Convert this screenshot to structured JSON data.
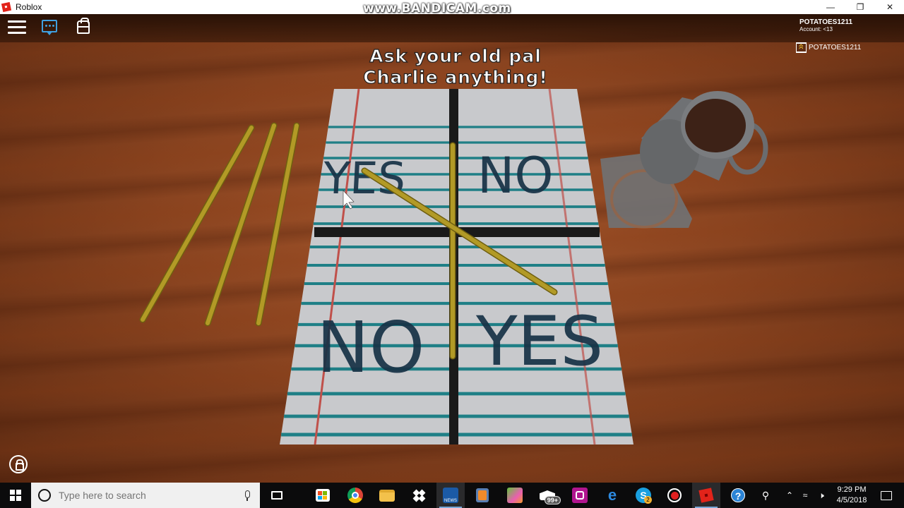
{
  "window": {
    "title": "Roblox",
    "watermark": "www.BANDICAM.com",
    "controls": {
      "minimize": "—",
      "restore": "❐",
      "close": "✕"
    }
  },
  "hud": {
    "menu_icon": "hamburger-menu-icon",
    "chat_icon": "chat-bubble-icon",
    "backpack_icon": "backpack-icon",
    "account_name": "POTATOES1211",
    "account_age": "Account: <13",
    "player_list": [
      {
        "name": "POTATOES1211",
        "badge": "premium-chevron-icon"
      }
    ],
    "shift_lock_icon": "shift-lock-icon"
  },
  "scene": {
    "sign_line1": "Ask your old pal",
    "sign_line2": "Charlie anything!",
    "board_labels": {
      "top_left": "YES",
      "top_right": "NO",
      "bottom_left": "NO",
      "bottom_right": "YES"
    },
    "objects": [
      "pencil",
      "pencil",
      "pencil",
      "pencil-vertical",
      "pencil-diagonal",
      "coffee-mug",
      "coaster"
    ],
    "colors": {
      "table_wood": "#8a4420",
      "paper": "#c8c9cc",
      "rule_line": "#1f7f86",
      "margin_line": "#c0504a",
      "grid_bar": "#1a1a1a",
      "label_text": "#173246",
      "pencil": "#b29a26",
      "mug": "#6f7174",
      "coffee": "#3d2217"
    }
  },
  "taskbar": {
    "search_placeholder": "Type here to search",
    "apps": [
      {
        "name": "task-view",
        "icon": "task-view-icon"
      },
      {
        "name": "microsoft-store",
        "icon": "store-icon"
      },
      {
        "name": "chrome",
        "icon": "chrome-icon"
      },
      {
        "name": "file-explorer",
        "icon": "folder-icon"
      },
      {
        "name": "dropbox",
        "icon": "dropbox-icon"
      },
      {
        "name": "abc-news",
        "icon": "abc-news-icon",
        "label": "NEWS"
      },
      {
        "name": "media-player",
        "icon": "play-icon"
      },
      {
        "name": "candy-crush",
        "icon": "candy-crush-icon"
      },
      {
        "name": "mail",
        "icon": "mail-icon",
        "badge": "99+"
      },
      {
        "name": "instagram",
        "icon": "instagram-icon"
      },
      {
        "name": "edge",
        "icon": "edge-icon"
      },
      {
        "name": "skype",
        "icon": "skype-icon",
        "badge": "2"
      },
      {
        "name": "bandicam",
        "icon": "record-icon"
      },
      {
        "name": "roblox",
        "icon": "roblox-icon"
      },
      {
        "name": "get-help",
        "icon": "help-icon"
      }
    ],
    "tray": {
      "people_icon": "people-icon",
      "chevron_icon": "chevron-up-icon",
      "network_icon": "wifi-icon",
      "volume_icon": "volume-icon",
      "time": "9:29 PM",
      "date": "4/5/2018",
      "notification_icon": "action-center-icon"
    }
  }
}
